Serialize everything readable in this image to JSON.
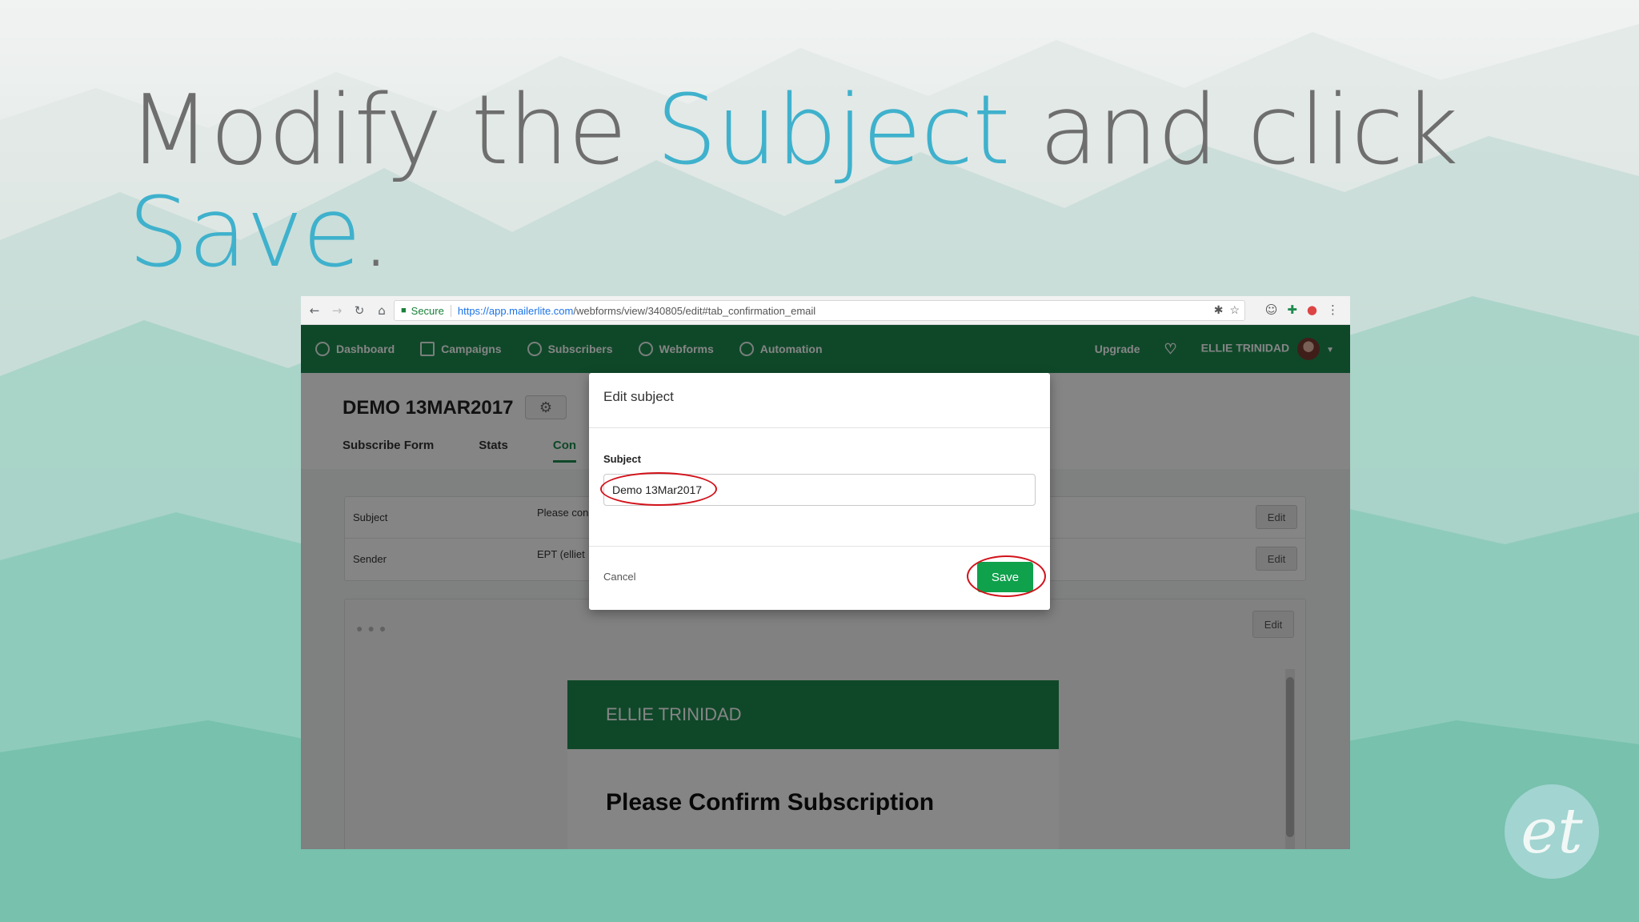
{
  "slide": {
    "title_part1": "Modify the ",
    "title_hl1": "Subject",
    "title_part2": " and click",
    "title_hl2": "Save",
    "title_end": "."
  },
  "browser": {
    "secure_label": "Secure",
    "url_host": "https://app.mailerlite.com",
    "url_path": "/webforms/view/340805/edit#tab_confirmation_email"
  },
  "topnav": {
    "items": [
      "Dashboard",
      "Campaigns",
      "Subscribers",
      "Webforms",
      "Automation"
    ],
    "upgrade": "Upgrade",
    "user": "ELLIE TRINIDAD"
  },
  "page": {
    "title": "DEMO 13MAR2017",
    "tabs": [
      "Subscribe Form",
      "Stats",
      "Con"
    ]
  },
  "settings": {
    "rows": [
      {
        "label": "Subject",
        "value": "Please con"
      },
      {
        "label": "Sender",
        "value": "EPT (elliet"
      }
    ],
    "edit_label": "Edit"
  },
  "preview": {
    "brand": "ELLIE TRINIDAD",
    "heading": "Please Confirm Subscription"
  },
  "modal": {
    "title": "Edit subject",
    "field_label": "Subject",
    "field_value": "Demo 13Mar2017",
    "cancel": "Cancel",
    "save": "Save"
  },
  "colors": {
    "brand_green": "#1d8a4f",
    "highlight_blue": "#3fb1cc",
    "annotation_red": "#d2121a"
  }
}
